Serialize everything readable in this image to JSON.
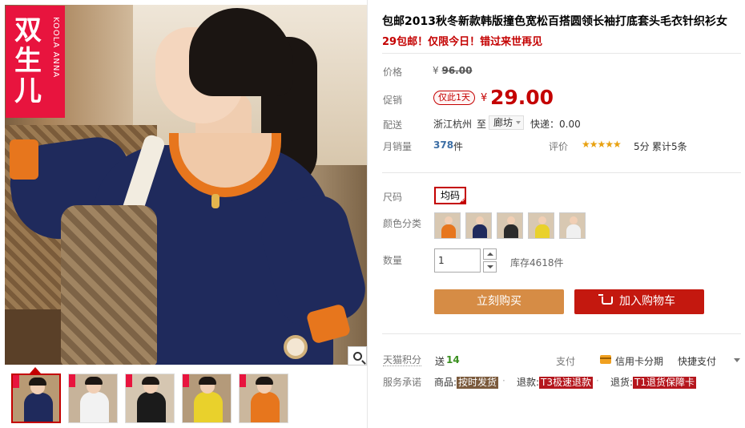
{
  "brand": {
    "cn": "双生儿",
    "en": "KOOLA ANNA"
  },
  "product": {
    "title": "包邮2013秋冬新款韩版撞色宽松百搭圆领长袖打底套头毛衣针织衫女",
    "subtitle": "29包邮！仅限今日！错过来世再见"
  },
  "price": {
    "label": "价格",
    "currency": "¥",
    "original": "96.00"
  },
  "promo": {
    "label": "促销",
    "tag": "仅此1天",
    "currency": "¥",
    "price": "29.00"
  },
  "shipping": {
    "label": "配送",
    "from": "浙江杭州",
    "to_prefix": "至",
    "destination": "廊坊",
    "express": "快递：0.00"
  },
  "sales": {
    "label": "月销量",
    "count": "378",
    "unit": "件"
  },
  "rating": {
    "label": "评价",
    "stars": "★★★★★",
    "score": "5分",
    "total": "累计5条"
  },
  "size": {
    "label": "尺码",
    "option": "均码"
  },
  "color": {
    "label": "颜色分类",
    "swatches": [
      "#e7761d",
      "#1f2a5c",
      "#2b2b2b",
      "#e9d12c",
      "#f0f0f0"
    ]
  },
  "quantity": {
    "label": "数量",
    "value": "1",
    "stock": "库存4618件"
  },
  "actions": {
    "buy_now": "立刻购买",
    "add_to_cart": "加入购物车"
  },
  "points": {
    "label": "天猫积分",
    "prefix": "送",
    "value": "14"
  },
  "payment": {
    "label": "支付",
    "credit": "信用卡分期",
    "quick": "快捷支付"
  },
  "service": {
    "label": "服务承诺",
    "goods_prefix": "商品:",
    "goods_tag": "按时发货",
    "refund_prefix": "退款:",
    "refund_tag": "T3极速退款",
    "return_prefix": "退货:",
    "return_tag": "T1退货保障卡"
  },
  "thumbnails": [
    {
      "color": "#1f2a5c",
      "bg": "#b89a74"
    },
    {
      "color": "#f2f2f2",
      "bg": "#c7b39a"
    },
    {
      "color": "#1b1b1b",
      "bg": "#d5c6b1"
    },
    {
      "color": "#e9d12c",
      "bg": "#b49a7a"
    },
    {
      "color": "#e7761d",
      "bg": "#cbb79d"
    }
  ]
}
